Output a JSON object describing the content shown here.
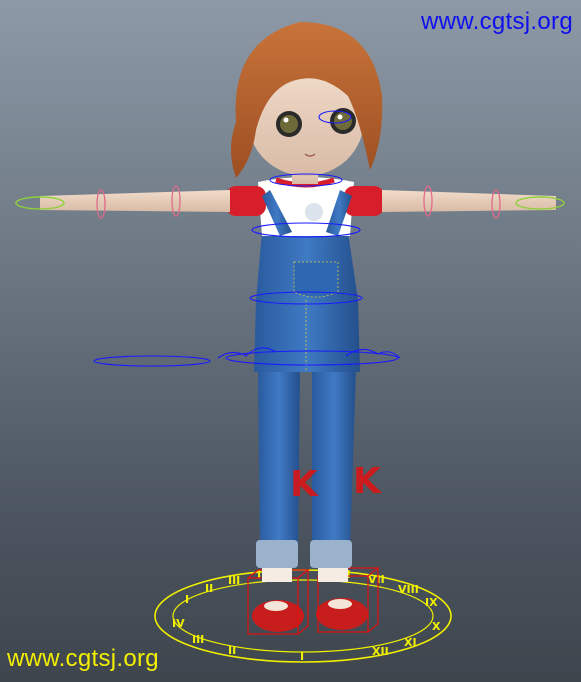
{
  "watermark_top": "www.cgtsj.org",
  "watermark_bottom": "www.cgtsj.org",
  "colors": {
    "watermark_top": "#1010ee",
    "watermark_bottom": "#f2ef00",
    "viewport_bg_top": "#8d99a6",
    "viewport_bg_bottom": "#3e454d",
    "rig_control_blue": "#1a1aff",
    "rig_control_pink": "#e26a8a",
    "ik_handle_red": "#e01010",
    "foot_ring_yellow": "#f0ef00",
    "hand_control_green": "#8ed13a"
  },
  "scene": {
    "ik_handle_left_label": "K",
    "ik_handle_right_label": "K"
  }
}
